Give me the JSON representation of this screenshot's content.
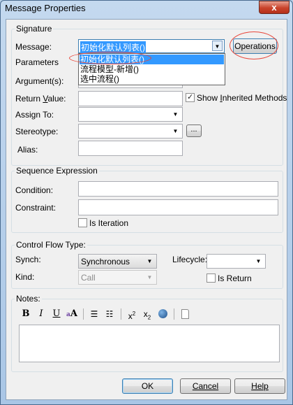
{
  "window": {
    "title": "Message Properties",
    "close_label": "x"
  },
  "signature": {
    "group_label": "Signature",
    "message_label": "Message:",
    "message_value": "初始化默认列表()",
    "operations_button": "Operations",
    "parameters_label": "Parameters",
    "arguments_label": "Argument(s):",
    "return_value_label_pre": "Return ",
    "return_value_label_u": "V",
    "return_value_label_post": "alue:",
    "show_inherited_label_pre": "Show ",
    "show_inherited_label_u": "I",
    "show_inherited_label_post": "nherited Methods",
    "show_inherited_checked": true,
    "assign_to_label": "Assign To:",
    "stereotype_label": "Stereotype:",
    "stereotype_button": "...",
    "alias_label": "Alias:",
    "dropdown_items": [
      "初始化默认列表()",
      "流程模型-新增()",
      "选中流程()"
    ]
  },
  "sequence": {
    "group_label": "Sequence Expression",
    "condition_label": "Condition:",
    "constraint_label": "Constraint:",
    "is_iteration_label": "Is Iteration",
    "is_iteration_checked": false
  },
  "control_flow": {
    "group_label": "Control Flow Type:",
    "synch_label": "Synch:",
    "synch_value": "Synchronous",
    "lifecycle_label": "Lifecycle:",
    "lifecycle_value": "",
    "kind_label": "Kind:",
    "kind_value": "Call",
    "is_return_label": "Is Return",
    "is_return_checked": false
  },
  "notes": {
    "group_label": "Notes:",
    "toolbar": [
      "bold-icon",
      "italic-icon",
      "underline-icon",
      "font-color-icon",
      "bullet-list-icon",
      "numbered-list-icon",
      "superscript-icon",
      "subscript-icon",
      "hyperlink-icon",
      "document-icon"
    ],
    "content": ""
  },
  "buttons": {
    "ok": "OK",
    "cancel": "Cancel",
    "help": "Help"
  }
}
